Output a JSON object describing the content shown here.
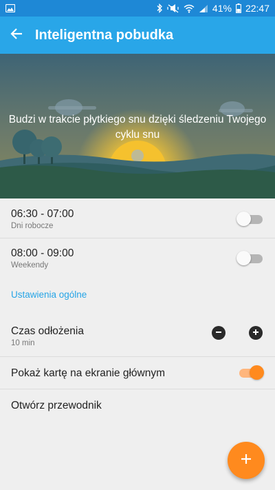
{
  "status_bar": {
    "battery": "41%",
    "time": "22:47",
    "icons": [
      "gallery-icon",
      "bluetooth-icon",
      "mute-vibrate-icon",
      "wifi-icon",
      "signal-icon",
      "battery-icon"
    ]
  },
  "app_bar": {
    "title": "Inteligentna pobudka",
    "back_icon": "arrow-back-icon"
  },
  "hero": {
    "description": "Budzi w trakcie płytkiego snu dzięki śledzeniu Twojego cyklu snu"
  },
  "alarms": [
    {
      "time_range": "06:30 - 07:00",
      "days": "Dni robocze",
      "enabled": false
    },
    {
      "time_range": "08:00 - 09:00",
      "days": "Weekendy",
      "enabled": false
    }
  ],
  "general_settings": {
    "header": "Ustawienia ogólne",
    "snooze": {
      "label": "Czas odłożenia",
      "value": "10 min",
      "decrease_icon": "minus-icon",
      "increase_icon": "plus-icon"
    },
    "show_card": {
      "label": "Pokaż kartę na ekranie głównym",
      "enabled": true
    },
    "open_guide": {
      "label": "Otwórz przewodnik"
    }
  },
  "fab": {
    "icon": "plus-icon"
  },
  "colors": {
    "status_bar": "#1e88d6",
    "app_bar": "#29a6e8",
    "accent": "#ff8a1e",
    "link": "#25a4e6",
    "background": "#efefef"
  }
}
